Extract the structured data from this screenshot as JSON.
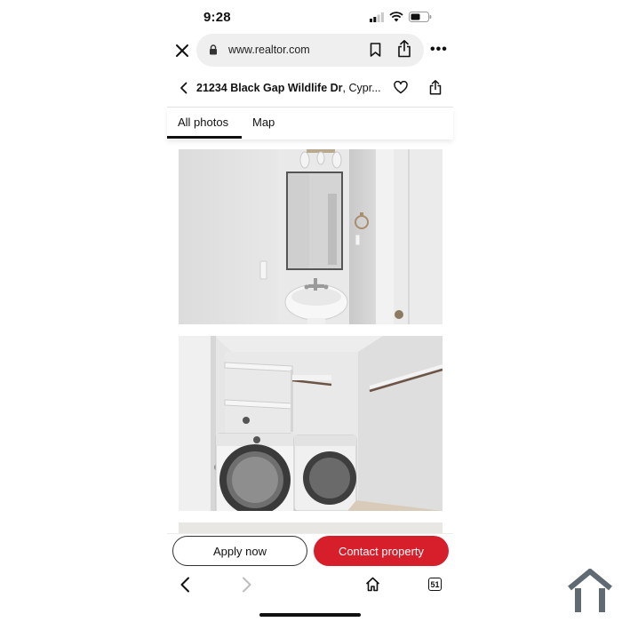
{
  "status_bar": {
    "time": "9:28"
  },
  "browser": {
    "url": "www.realtor.com"
  },
  "listing": {
    "address_bold": "21234 Black Gap Wildlife Dr",
    "address_rest": ", Cypr..."
  },
  "tabs": [
    {
      "label": "All photos",
      "active": true
    },
    {
      "label": "Map",
      "active": false
    }
  ],
  "actions": {
    "apply_label": "Apply now",
    "contact_label": "Contact property",
    "contact_color": "#d61f2b"
  },
  "bottom_nav": {
    "tab_count": "51"
  }
}
